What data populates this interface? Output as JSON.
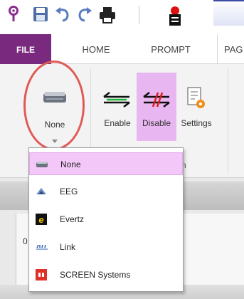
{
  "tabs": {
    "file": "FILE",
    "home": "HOME",
    "prompt": "PROMPT",
    "pag": "PAG"
  },
  "ribbon": {
    "none_label": "None",
    "enable_label": "Enable",
    "disable_label": "Disable",
    "settings_label": "Settings",
    "group_partial": "n"
  },
  "doc": {
    "row_number": "0"
  },
  "dropdown": {
    "items": [
      {
        "label": "None",
        "icon": "device-icon"
      },
      {
        "label": "EEG",
        "icon": "eeg-icon"
      },
      {
        "label": "Evertz",
        "icon": "evertz-icon"
      },
      {
        "label": "Link",
        "icon": "link-icon"
      },
      {
        "label": "SCREEN Systems",
        "icon": "screen-systems-icon"
      }
    ],
    "selected_index": 0
  },
  "colors": {
    "file_tab": "#7a2a7e",
    "highlight": "#f3c7f7",
    "disable_highlight": "#e8b6f0",
    "annotation_circle": "#e05a55"
  }
}
